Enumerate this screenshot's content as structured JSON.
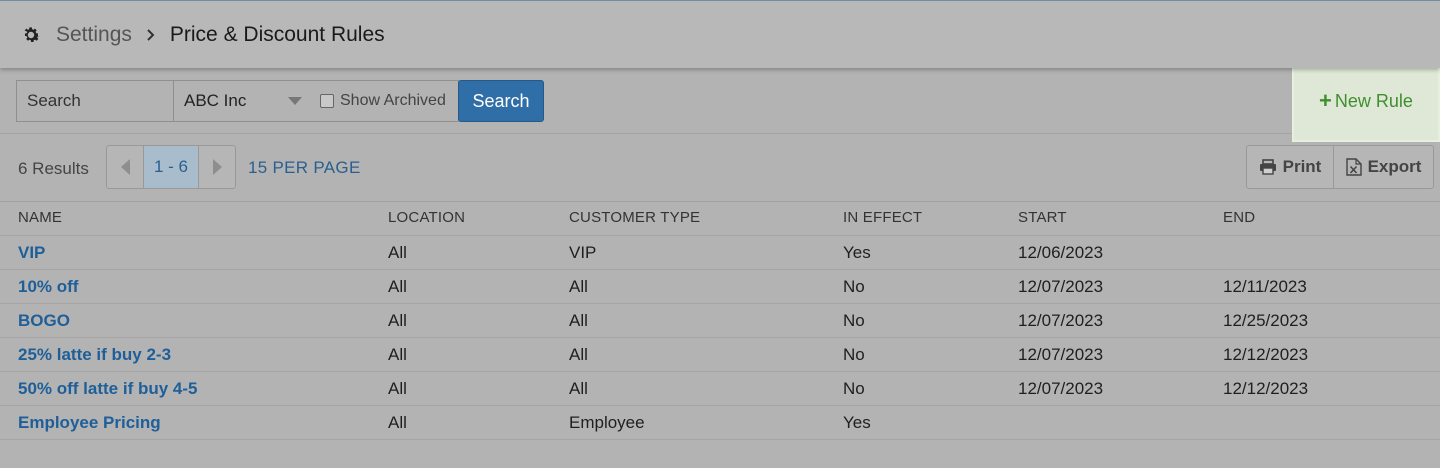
{
  "breadcrumb": {
    "root": "Settings",
    "current": "Price & Discount Rules"
  },
  "toolbar": {
    "search_placeholder": "Search",
    "company_select": "ABC Inc",
    "show_archived_label": "Show Archived",
    "show_archived_checked": false,
    "search_button": "Search",
    "new_rule_label": "New Rule"
  },
  "results": {
    "count_label": "6 Results",
    "page_range": "1 - 6",
    "per_page": "15 PER PAGE",
    "print_label": "Print",
    "export_label": "Export"
  },
  "table": {
    "headers": [
      "NAME",
      "LOCATION",
      "CUSTOMER TYPE",
      "IN EFFECT",
      "START",
      "END"
    ],
    "rows": [
      {
        "name": "VIP",
        "location": "All",
        "customer_type": "VIP",
        "in_effect": "Yes",
        "start": "12/06/2023",
        "end": ""
      },
      {
        "name": "10% off",
        "location": "All",
        "customer_type": "All",
        "in_effect": "No",
        "start": "12/07/2023",
        "end": "12/11/2023"
      },
      {
        "name": "BOGO",
        "location": "All",
        "customer_type": "All",
        "in_effect": "No",
        "start": "12/07/2023",
        "end": "12/25/2023"
      },
      {
        "name": "25% latte if buy 2-3",
        "location": "All",
        "customer_type": "All",
        "in_effect": "No",
        "start": "12/07/2023",
        "end": "12/12/2023"
      },
      {
        "name": "50% off latte if buy 4-5",
        "location": "All",
        "customer_type": "All",
        "in_effect": "No",
        "start": "12/07/2023",
        "end": "12/12/2023"
      },
      {
        "name": "Employee Pricing",
        "location": "All",
        "customer_type": "Employee",
        "in_effect": "Yes",
        "start": "",
        "end": ""
      }
    ]
  },
  "icons": {
    "settings": "gear-icon",
    "breadcrumb_separator": "chevron-right-icon",
    "select_caret": "caret-down-icon",
    "new_rule": "plus-icon",
    "prev": "arrow-left-icon",
    "next": "arrow-right-icon",
    "print": "printer-icon",
    "export": "excel-file-icon"
  },
  "colors": {
    "accent_blue": "#2f6ea6",
    "link_blue": "#1f5f99",
    "new_rule_green": "#3f8f2e",
    "new_rule_highlight": "#dfe8d6"
  }
}
